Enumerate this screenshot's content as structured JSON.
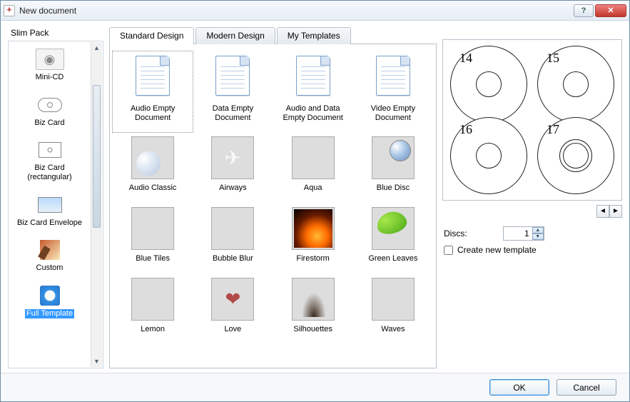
{
  "window": {
    "title": "New document"
  },
  "sidebar": {
    "header": "Slim Pack",
    "selected": "full-template",
    "items": [
      {
        "id": "mini-cd",
        "label": "Mini-CD"
      },
      {
        "id": "biz-card",
        "label": "Biz Card"
      },
      {
        "id": "biz-card-rect",
        "label": "Biz Card (rectangular)"
      },
      {
        "id": "biz-card-env",
        "label": "Biz Card Envelope"
      },
      {
        "id": "custom",
        "label": "Custom"
      },
      {
        "id": "full-template",
        "label": "Full Template"
      }
    ]
  },
  "tabs": {
    "active": "standard",
    "items": [
      {
        "id": "standard",
        "label": "Standard Design"
      },
      {
        "id": "modern",
        "label": "Modern Design"
      },
      {
        "id": "my",
        "label": "My Templates"
      }
    ]
  },
  "templates": [
    {
      "id": "audio-empty",
      "label": "Audio Empty Document",
      "kind": "doc",
      "selected": true
    },
    {
      "id": "data-empty",
      "label": "Data Empty Document",
      "kind": "doc"
    },
    {
      "id": "audio-data-empty",
      "label": "Audio and Data Empty Document",
      "kind": "doc"
    },
    {
      "id": "video-empty",
      "label": "Video Empty Document",
      "kind": "doc"
    },
    {
      "id": "audio-classic",
      "label": "Audio Classic",
      "kind": "img",
      "cls": "im-classic"
    },
    {
      "id": "airways",
      "label": "Airways",
      "kind": "img",
      "cls": "im-airways"
    },
    {
      "id": "aqua",
      "label": "Aqua",
      "kind": "img",
      "cls": "im-aqua"
    },
    {
      "id": "blue-disc",
      "label": "Blue Disc",
      "kind": "img",
      "cls": "im-bluedisc"
    },
    {
      "id": "blue-tiles",
      "label": "Blue Tiles",
      "kind": "img",
      "cls": "im-bluetiles"
    },
    {
      "id": "bubble-blur",
      "label": "Bubble Blur",
      "kind": "img",
      "cls": "im-bubble"
    },
    {
      "id": "firestorm",
      "label": "Firestorm",
      "kind": "img",
      "cls": "im-firestorm"
    },
    {
      "id": "green-leaves",
      "label": "Green Leaves",
      "kind": "img",
      "cls": "im-green"
    },
    {
      "id": "lemon",
      "label": "Lemon",
      "kind": "img",
      "cls": "im-lemon"
    },
    {
      "id": "love",
      "label": "Love",
      "kind": "img",
      "cls": "im-love"
    },
    {
      "id": "silhouettes",
      "label": "Silhouettes",
      "kind": "img",
      "cls": "im-sil"
    },
    {
      "id": "waves",
      "label": "Waves",
      "kind": "img",
      "cls": "im-waves"
    }
  ],
  "preview": {
    "labels": [
      "14",
      "15",
      "16",
      "17"
    ]
  },
  "options": {
    "discs_label": "Discs:",
    "discs_value": "1",
    "create_new_label": "Create new template",
    "create_new_checked": false
  },
  "buttons": {
    "ok": "OK",
    "cancel": "Cancel"
  }
}
